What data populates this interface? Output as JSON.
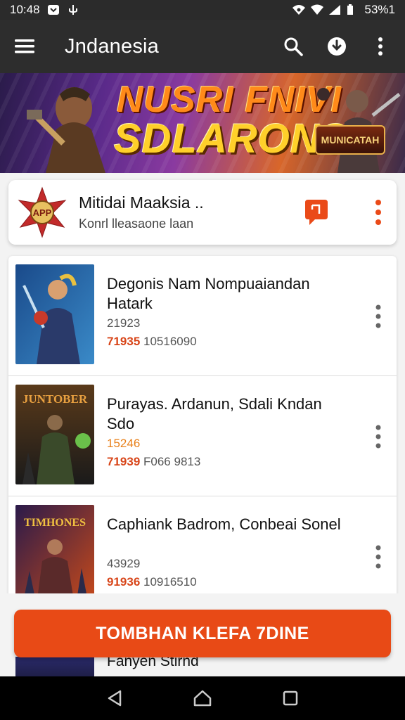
{
  "status_bar": {
    "time": "10:48",
    "battery": "53%1"
  },
  "app_bar": {
    "title": "Jndanesia",
    "icons": [
      "menu-icon",
      "search-icon",
      "download-icon",
      "more-vert-icon"
    ]
  },
  "banner": {
    "line1": "NUSRI FNIVI",
    "line2": "SDLARONS",
    "badge": "MUNICATAH"
  },
  "featured": {
    "logo_text": "APP",
    "name": "Mitidai Maaksia ..",
    "subtitle": "Konrl lleasaone laan"
  },
  "items": [
    {
      "title": "Degonis Nam Nompuaiandan Hatark",
      "count": "21923",
      "stat_highlight": "71935",
      "stat_rest": "10516090"
    },
    {
      "title": "Purayas. Ardanun, Sdali Kndan Sdo",
      "count": "15246",
      "stat_highlight": "71939",
      "stat_rest": "F066 9813"
    },
    {
      "title": "Caphiank Badrom, Conbeai Sonel",
      "count": "43929",
      "stat_highlight": "91936",
      "stat_rest": "10916510"
    }
  ],
  "thumb_labels": [
    "",
    "JUNTOBER",
    "TIMHONES"
  ],
  "peek_item": {
    "title": "Fanyen Stirnd"
  },
  "cta": {
    "label": "TOMBHAN KLEFA 7DINE"
  },
  "colors": {
    "accent": "#e84a16",
    "appbar": "#2d2d2d",
    "card": "#ffffff"
  }
}
